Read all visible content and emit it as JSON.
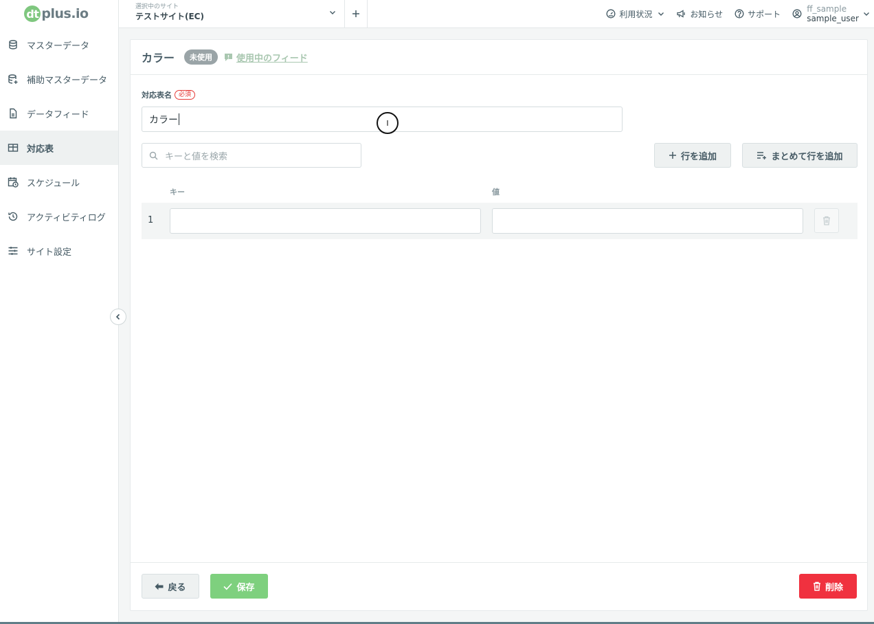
{
  "brand": {
    "logo_badge": "dt",
    "logo_text": "plus.io"
  },
  "sidebar": {
    "items": [
      {
        "label": "マスターデータ",
        "icon": "database-icon"
      },
      {
        "label": "補助マスターデータ",
        "icon": "database-plus-icon"
      },
      {
        "label": "データフィード",
        "icon": "file-icon"
      },
      {
        "label": "対応表",
        "icon": "table-icon",
        "active": true
      },
      {
        "label": "スケジュール",
        "icon": "calendar-clock-icon"
      },
      {
        "label": "アクティビティログ",
        "icon": "history-icon"
      },
      {
        "label": "サイト設定",
        "icon": "sliders-icon"
      }
    ]
  },
  "header": {
    "site_caption": "選択中のサイト",
    "site_name": "テストサイト(EC)",
    "usage": "利用状況",
    "news": "お知らせ",
    "support": "サポート",
    "user_org": "ff_sample",
    "user_name": "sample_user"
  },
  "card": {
    "title": "カラー",
    "status_badge": "未使用",
    "feeds_link": "使用中のフィード",
    "field_label": "対応表名",
    "required_badge": "必須",
    "name_value": "カラー",
    "search_placeholder": "キーと値を検索",
    "add_row": "行を追加",
    "add_rows_bulk": "まとめて行を追加",
    "col_key": "キー",
    "col_value": "値",
    "rows": [
      {
        "num": "1",
        "key": "",
        "value": ""
      }
    ],
    "back": "戻る",
    "save": "保存",
    "delete": "削除"
  },
  "cursor_glyph": "I",
  "colors": {
    "accent_green": "#7ed07e",
    "danger_red": "#f0313f",
    "text": "#455a64"
  }
}
